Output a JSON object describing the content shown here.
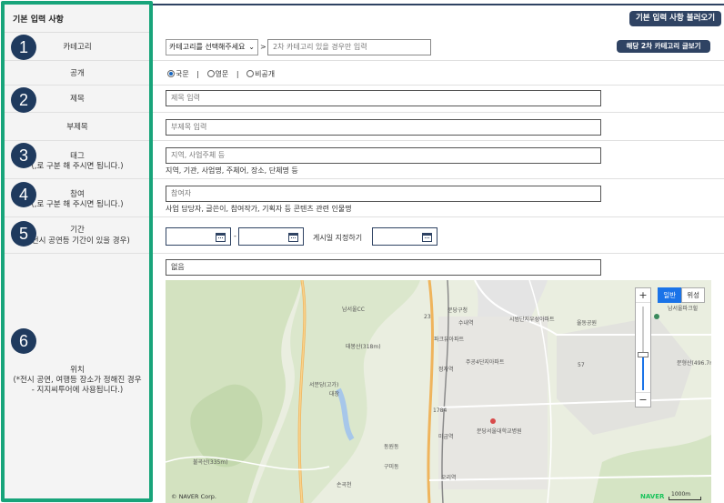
{
  "section_title": "기본 입력 사항",
  "load_button": "기본 입력 사항 불러오기",
  "category": {
    "label": "카테고리",
    "select_value": "카테고리를 선택해주세요",
    "separator": ">",
    "sub_placeholder": "2차 카테고리 있을 경우만 입력",
    "view_button": "해당 2차 카테고리 글보기"
  },
  "visibility": {
    "label": "공개",
    "options": [
      "국문",
      "영문",
      "비공개"
    ],
    "selected": "국문",
    "divider": "|"
  },
  "title": {
    "label": "제목",
    "placeholder": "제목 입력"
  },
  "subtitle": {
    "label": "부제목",
    "placeholder": "부제목 입력"
  },
  "tags": {
    "label": "태그",
    "label_note": "(,로 구분 해 주시면 됩니다.)",
    "placeholder": "지역, 사업주체 등",
    "helper": "지역, 기관, 사업명, 주체어, 장소, 단체명 등"
  },
  "participants": {
    "label": "참여",
    "label_note": "(,로 구분 해 주시면 됩니다.)",
    "placeholder": "참여자",
    "helper": "사업 담당자, 글쓴이, 참여작가, 기획자 등 콘텐츠 관련 인물명"
  },
  "period": {
    "label": "기간",
    "label_note": "(*전시 공연등 기간이 있을 경우)",
    "separator": "-",
    "post_date_label": "게시일 지정하기"
  },
  "location": {
    "label": "위치",
    "label_note": [
      "(*전시 공연, 여행등 장소가 정해진 경우",
      "- 지지씨투어에 사용됩니다.)"
    ],
    "placeholder": "없음"
  },
  "badges": [
    "1",
    "2",
    "3",
    "4",
    "5",
    "6"
  ],
  "map": {
    "type_normal": "일반",
    "type_satellite": "위성",
    "zoom_in": "+",
    "zoom_out": "−",
    "copyright": "© NAVER Corp.",
    "brand": "NAVER",
    "scale": "1000m",
    "labels": [
      "남서울CC",
      "불곡산(335m)",
      "운중동",
      "서분당(고가)",
      "대장",
      "정자역",
      "수내역",
      "분당구청",
      "미금역",
      "오리역",
      "분당서울대학교병원",
      "시범단지우성아파트",
      "율동공원",
      "남서울파크힐",
      "태봉산(318m)",
      "청계산",
      "불곡산",
      "동원동",
      "구미동",
      "손곡천",
      "광교산",
      "문형산(496.7m)",
      "파크뷰아파트",
      "주공4단지아파트",
      "1784",
      "23",
      "57"
    ]
  }
}
